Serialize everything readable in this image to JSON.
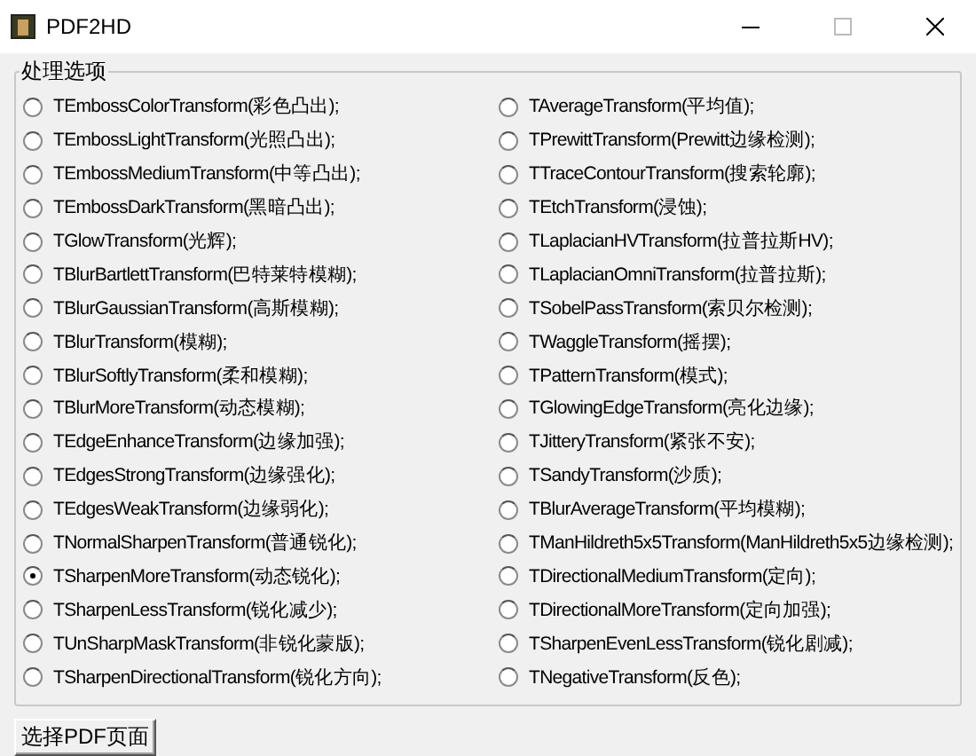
{
  "window": {
    "title": "PDF2HD"
  },
  "group": {
    "title": "处理选项",
    "columns": [
      [
        {
          "label": "TEmbossColorTransform(彩色凸出);",
          "selected": false
        },
        {
          "label": "TEmbossLightTransform(光照凸出);",
          "selected": false
        },
        {
          "label": "TEmbossMediumTransform(中等凸出);",
          "selected": false
        },
        {
          "label": "TEmbossDarkTransform(黑暗凸出);",
          "selected": false
        },
        {
          "label": "TGlowTransform(光辉);",
          "selected": false
        },
        {
          "label": "TBlurBartlettTransform(巴特莱特模糊);",
          "selected": false
        },
        {
          "label": "TBlurGaussianTransform(高斯模糊);",
          "selected": false
        },
        {
          "label": "TBlurTransform(模糊);",
          "selected": false
        },
        {
          "label": "TBlurSoftlyTransform(柔和模糊);",
          "selected": false
        },
        {
          "label": "TBlurMoreTransform(动态模糊);",
          "selected": false
        },
        {
          "label": "TEdgeEnhanceTransform(边缘加强);",
          "selected": false
        },
        {
          "label": "TEdgesStrongTransform(边缘强化);",
          "selected": false
        },
        {
          "label": "TEdgesWeakTransform(边缘弱化);",
          "selected": false
        },
        {
          "label": "TNormalSharpenTransform(普通锐化);",
          "selected": false
        },
        {
          "label": "TSharpenMoreTransform(动态锐化);",
          "selected": true
        },
        {
          "label": "TSharpenLessTransform(锐化减少);",
          "selected": false
        },
        {
          "label": "TUnSharpMaskTransform(非锐化蒙版);",
          "selected": false
        },
        {
          "label": "TSharpenDirectionalTransform(锐化方向);",
          "selected": false
        }
      ],
      [
        {
          "label": "TAverageTransform(平均值);",
          "selected": false
        },
        {
          "label": "TPrewittTransform(Prewitt边缘检测);",
          "selected": false
        },
        {
          "label": "TTraceContourTransform(搜索轮廓);",
          "selected": false
        },
        {
          "label": "TEtchTransform(浸蚀);",
          "selected": false
        },
        {
          "label": "TLaplacianHVTransform(拉普拉斯HV);",
          "selected": false
        },
        {
          "label": "TLaplacianOmniTransform(拉普拉斯);",
          "selected": false
        },
        {
          "label": "TSobelPassTransform(索贝尔检测);",
          "selected": false
        },
        {
          "label": "TWaggleTransform(摇摆);",
          "selected": false
        },
        {
          "label": "TPatternTransform(模式);",
          "selected": false
        },
        {
          "label": "TGlowingEdgeTransform(亮化边缘);",
          "selected": false
        },
        {
          "label": "TJitteryTransform(紧张不安);",
          "selected": false
        },
        {
          "label": "TSandyTransform(沙质);",
          "selected": false
        },
        {
          "label": "TBlurAverageTransform(平均模糊);",
          "selected": false
        },
        {
          "label": "TManHildreth5x5Transform(ManHildreth5x5边缘检测);",
          "selected": false
        },
        {
          "label": "TDirectionalMediumTransform(定向);",
          "selected": false
        },
        {
          "label": "TDirectionalMoreTransform(定向加强);",
          "selected": false
        },
        {
          "label": "TSharpenEvenLessTransform(锐化剧减);",
          "selected": false
        },
        {
          "label": "TNegativeTransform(反色);",
          "selected": false
        }
      ]
    ]
  },
  "button": "选择PDF页面"
}
